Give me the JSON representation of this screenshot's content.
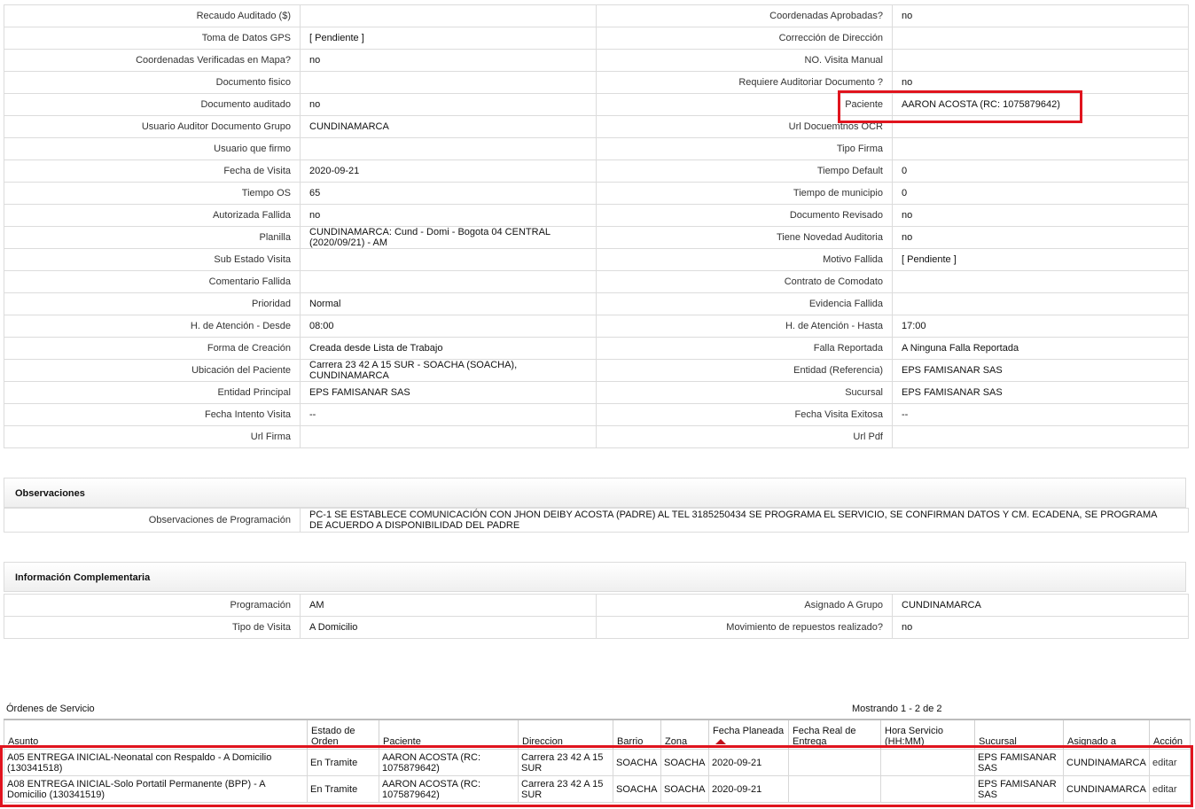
{
  "detail_rows": [
    {
      "l1": "Recaudo Auditado ($)",
      "v1": "",
      "l2": "Coordenadas Aprobadas?",
      "v2": "no"
    },
    {
      "l1": "Toma de Datos GPS",
      "v1": "[ Pendiente ]",
      "l2": "Corrección de Dirección",
      "v2": ""
    },
    {
      "l1": "Coordenadas Verificadas en Mapa?",
      "v1": "no",
      "l2": "NO. Visita Manual",
      "v2": ""
    },
    {
      "l1": "Documento fisico",
      "v1": "",
      "l2": "Requiere Auditoriar Documento ?",
      "v2": "no"
    },
    {
      "l1": "Documento auditado",
      "v1": "no",
      "l2": "Paciente",
      "v2": "AARON ACOSTA (RC: 1075879642)"
    },
    {
      "l1": "Usuario Auditor Documento Grupo",
      "v1": "CUNDINAMARCA",
      "l2": "Url Docuemtnos OCR",
      "v2": ""
    },
    {
      "l1": "Usuario que firmo",
      "v1": "",
      "l2": "Tipo Firma",
      "v2": ""
    },
    {
      "l1": "Fecha de Visita",
      "v1": "2020-09-21",
      "l2": "Tiempo Default",
      "v2": "0"
    },
    {
      "l1": "Tiempo OS",
      "v1": "65",
      "l2": "Tiempo de municipio",
      "v2": "0"
    },
    {
      "l1": "Autorizada Fallida",
      "v1": "no",
      "l2": "Documento Revisado",
      "v2": "no"
    },
    {
      "l1": "Planilla",
      "v1": "CUNDINAMARCA: Cund - Domi - Bogota 04 CENTRAL (2020/09/21) - AM",
      "l2": "Tiene Novedad Auditoria",
      "v2": "no"
    },
    {
      "l1": "Sub Estado Visita",
      "v1": "",
      "l2": "Motivo Fallida",
      "v2": "[ Pendiente ]"
    },
    {
      "l1": "Comentario Fallida",
      "v1": "",
      "l2": "Contrato de Comodato",
      "v2": ""
    },
    {
      "l1": "Prioridad",
      "v1": "Normal",
      "l2": "Evidencia Fallida",
      "v2": ""
    },
    {
      "l1": "H. de Atención - Desde",
      "v1": "08:00",
      "l2": "H. de Atención - Hasta",
      "v2": "17:00"
    },
    {
      "l1": "Forma de Creación",
      "v1": "Creada desde Lista de Trabajo",
      "l2": "Falla Reportada",
      "v2": "A Ninguna Falla Reportada"
    },
    {
      "l1": "Ubicación del Paciente",
      "v1": "Carrera 23 42 A 15 SUR - SOACHA (SOACHA), CUNDINAMARCA",
      "l2": "Entidad (Referencia)",
      "v2": "EPS FAMISANAR SAS"
    },
    {
      "l1": "Entidad Principal",
      "v1": "EPS FAMISANAR SAS",
      "l2": "Sucursal",
      "v2": "EPS FAMISANAR SAS"
    },
    {
      "l1": "Fecha Intento Visita",
      "v1": "--",
      "l2": "Fecha Visita Exitosa",
      "v2": "--"
    },
    {
      "l1": "Url Firma",
      "v1": "",
      "l2": "Url Pdf",
      "v2": ""
    }
  ],
  "observaciones": {
    "title": "Observaciones",
    "label": "Observaciones de Programación",
    "value": "PC-1 SE ESTABLECE COMUNICACIÓN CON JHON DEIBY ACOSTA (PADRE) AL TEL 3185250434 SE PROGRAMA EL SERVICIO, SE CONFIRMAN DATOS Y CM. ECADENA, SE PROGRAMA DE ACUERDO A DISPONIBILIDAD DEL PADRE"
  },
  "complementaria": {
    "title": "Información Complementaria",
    "rows": [
      {
        "l1": "Programación",
        "v1": "AM",
        "l2": "Asignado A Grupo",
        "v2": "CUNDINAMARCA"
      },
      {
        "l1": "Tipo de Visita",
        "v1": "A Domicilio",
        "l2": "Movimiento de repuestos realizado?",
        "v2": "no"
      }
    ]
  },
  "ordenes": {
    "title": "Órdenes de Servicio",
    "count": "Mostrando 1 - 2 de 2",
    "columns": [
      "Asunto",
      "Estado de Orden",
      "Paciente",
      "Direccion",
      "Barrio",
      "Zona",
      "Fecha Planeada",
      "Fecha Real de Entrega",
      "Hora Servicio (HH:MM)",
      "Sucursal",
      "Asignado a",
      "Acción"
    ],
    "rows": [
      {
        "asunto": "A05 ENTREGA INICIAL-Neonatal con Respaldo - A Domicilio (130341518)",
        "estado": "En Tramite",
        "paciente": "AARON ACOSTA (RC: 1075879642)",
        "direccion": "Carrera 23 42 A 15 SUR",
        "barrio": "SOACHA",
        "zona": "SOACHA",
        "fecha": "2020-09-21",
        "fecha_real": "",
        "hora": "",
        "sucursal": "EPS FAMISANAR SAS",
        "asignado": "CUNDINAMARCA",
        "accion": "editar"
      },
      {
        "asunto": "A08 ENTREGA INICIAL-Solo Portatil Permanente (BPP) - A Domicilio (130341519)",
        "estado": "En Tramite",
        "paciente": "AARON ACOSTA (RC: 1075879642)",
        "direccion": "Carrera 23 42 A 15 SUR",
        "barrio": "SOACHA",
        "zona": "SOACHA",
        "fecha": "2020-09-21",
        "fecha_real": "",
        "hora": "",
        "sucursal": "EPS FAMISANAR SAS",
        "asignado": "CUNDINAMARCA",
        "accion": "editar"
      }
    ]
  }
}
